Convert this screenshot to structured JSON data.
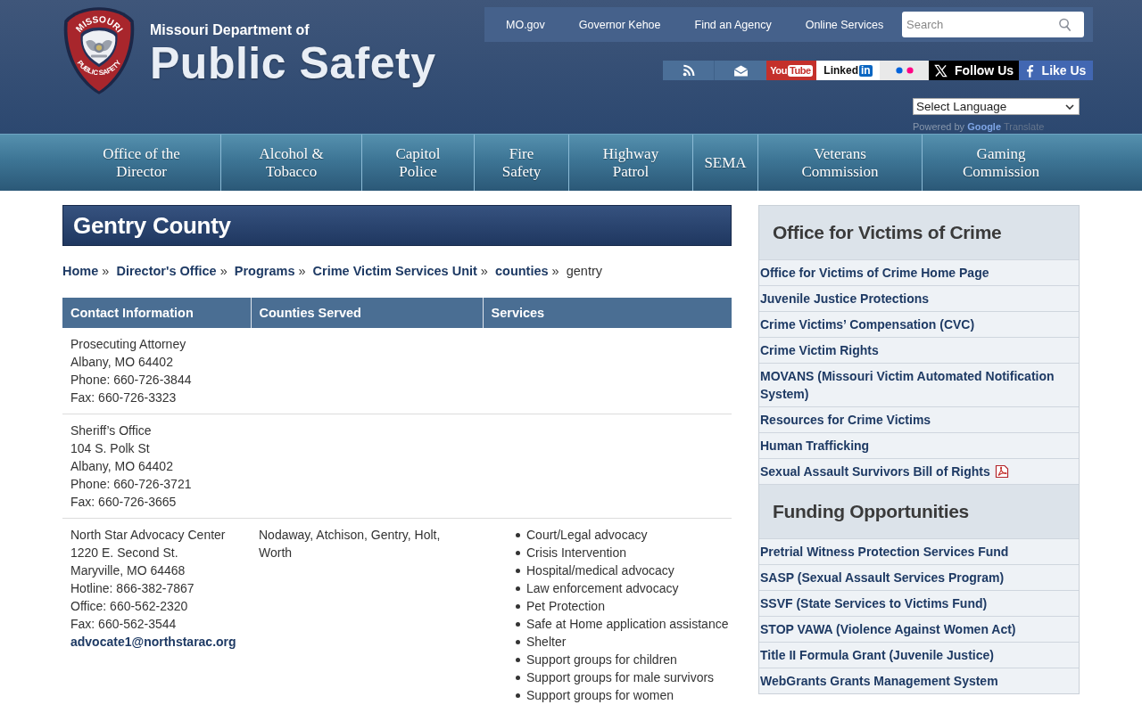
{
  "header": {
    "logo": {
      "badge_top": "MISSOURI",
      "badge_bottom": "PUBLIC SAFETY",
      "subtitle": "Missouri Department of",
      "title": "Public Safety"
    },
    "utility_links": [
      "MO.gov",
      "Governor Kehoe",
      "Find an Agency",
      "Online Services"
    ],
    "search": {
      "placeholder": "Search"
    },
    "social": [
      {
        "kind": "rss"
      },
      {
        "kind": "email"
      },
      {
        "kind": "youtube",
        "label": "You",
        "badge": "Tube"
      },
      {
        "kind": "linkedin",
        "label": "Linked",
        "badge": "in"
      },
      {
        "kind": "flickr"
      },
      {
        "kind": "x",
        "label": "Follow Us"
      },
      {
        "kind": "facebook",
        "label": "Like Us"
      }
    ],
    "translate": {
      "value": "Select Language",
      "powered_by": "Powered by",
      "brand": "Google",
      "service": "Translate"
    }
  },
  "nav": [
    "Office of the\nDirector",
    "Alcohol &\nTobacco",
    "Capitol\nPolice",
    "Fire\nSafety",
    "Highway\nPatrol",
    "SEMA",
    "Veterans\nCommission",
    "Gaming\nCommission"
  ],
  "page_title": "Gentry County",
  "breadcrumb": [
    {
      "label": "Home",
      "current": false
    },
    {
      "separator": "»",
      "label": "Director's Office",
      "current": false
    },
    {
      "separator": "»",
      "label": "Programs",
      "current": false
    },
    {
      "separator": "»",
      "label": "Crime Victim Services Unit",
      "current": false
    },
    {
      "separator": "»",
      "label": "counties",
      "current": false
    },
    {
      "separator": "»",
      "label": "gentry",
      "current": true
    }
  ],
  "table": {
    "columns": [
      "Contact Information",
      "Counties Served",
      "Services"
    ],
    "rows": [
      {
        "contact": [
          "Prosecuting Attorney",
          "Albany, MO 64402",
          "Phone: 660-726-3844",
          "Fax: 660-726-3323"
        ]
      },
      {
        "contact": [
          "Sheriff’s Office",
          "104 S. Polk St",
          "Albany, MO 64402",
          "Phone: 660-726-3721",
          "Fax: 660-726-3665"
        ]
      },
      {
        "contact": [
          "North Star Advocacy Center",
          "1220 E. Second St.",
          "Maryville, MO 64468",
          "Hotline: 866-382-7867",
          "Office: 660-562-2320",
          "Fax: 660-562-3544"
        ],
        "email": "advocate1@northstarac.org",
        "counties": "Nodaway, Atchison, Gentry, Holt, Worth",
        "services": [
          "Court/Legal advocacy",
          "Crisis Intervention",
          "Hospital/medical advocacy",
          "Law enforcement advocacy",
          "Pet Protection",
          "Safe at Home application assistance",
          "Shelter",
          "Support groups for children",
          "Support groups for male survivors",
          "Support groups for women"
        ]
      }
    ]
  },
  "sidebar": [
    {
      "heading": "Office for Victims of Crime",
      "links": [
        {
          "kind": "link",
          "label": "Office for Victims of Crime Home Page"
        },
        {
          "kind": "link",
          "label": "Juvenile Justice Protections"
        },
        {
          "kind": "link",
          "label": "Crime Victims’ Compensation (CVC)"
        },
        {
          "kind": "link",
          "label": "Crime Victim Rights"
        },
        {
          "kind": "link",
          "label": "MOVANS (Missouri Victim Automated Notification System)"
        },
        {
          "kind": "link",
          "label": "Resources for Crime Victims"
        },
        {
          "kind": "link",
          "label": "Human Trafficking"
        },
        {
          "kind": "pdf_link",
          "label": "Sexual Assault Survivors Bill of Rights"
        }
      ]
    },
    {
      "heading": "Funding Opportunities",
      "links": [
        {
          "kind": "link",
          "label": "Pretrial Witness Protection Services Fund"
        },
        {
          "kind": "link",
          "label": "SASP (Sexual Assault Services Program)"
        },
        {
          "kind": "link",
          "label": "SSVF (State Services to Victims Fund)"
        },
        {
          "kind": "link",
          "label": "STOP VAWA (Violence Against Women Act)"
        },
        {
          "kind": "link",
          "label": "Title II Formula Grant (Juvenile Justice)"
        },
        {
          "kind": "link",
          "label": "WebGrants Grants Management System"
        }
      ]
    }
  ]
}
